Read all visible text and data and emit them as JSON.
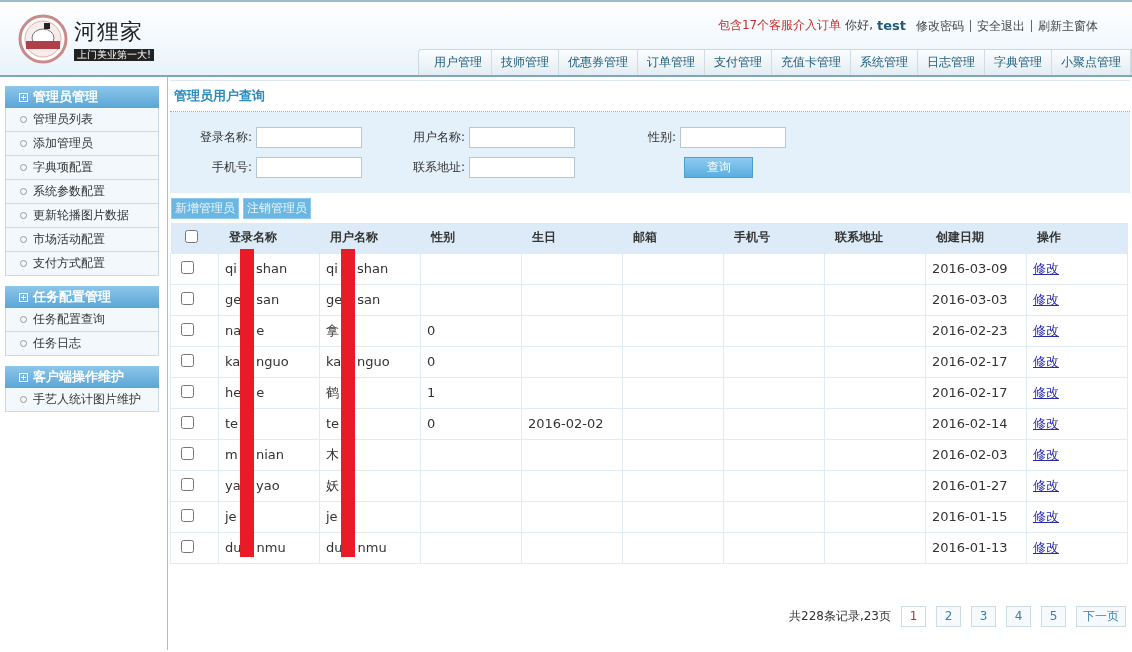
{
  "brand": {
    "name": "河狸家",
    "tagline": "上门美业第一大!"
  },
  "top_bar": {
    "alert": "包含17个客服介入订单",
    "greeting": "你好,",
    "user": "test",
    "links": [
      "修改密码",
      "安全退出",
      "刷新主窗体"
    ]
  },
  "nav_tabs": [
    "用户管理",
    "技师管理",
    "优惠券管理",
    "订单管理",
    "支付管理",
    "充值卡管理",
    "系统管理",
    "日志管理",
    "字典管理",
    "小聚点管理"
  ],
  "sidebar": [
    {
      "title": "管理员管理",
      "items": [
        "管理员列表",
        "添加管理员",
        "字典项配置",
        "系统参数配置",
        "更新轮播图片数据",
        "市场活动配置",
        "支付方式配置"
      ]
    },
    {
      "title": "任务配置管理",
      "items": [
        "任务配置查询",
        "任务日志"
      ]
    },
    {
      "title": "客户端操作维护",
      "items": [
        "手艺人统计图片维护"
      ]
    }
  ],
  "page_title": "管理员用户查询",
  "filters": [
    {
      "label": "登录名称:"
    },
    {
      "label": "用户名称:"
    },
    {
      "label": "性别:"
    },
    {
      "label": "手机号:"
    },
    {
      "label": "联系地址:"
    }
  ],
  "query_button": "查询",
  "actions": [
    "新增管理员",
    "注销管理员"
  ],
  "table": {
    "select_all_checked": false,
    "columns": [
      "登录名称",
      "用户名称",
      "性别",
      "生日",
      "邮箱",
      "手机号",
      "联系地址",
      "创建日期",
      "操作"
    ],
    "rows": [
      {
        "checked": false,
        "login_name": [
          "qi",
          "shan"
        ],
        "user_name": [
          "qi",
          "shan"
        ],
        "gender": "",
        "birthday": "",
        "created": "2016-03-09",
        "action": "修改"
      },
      {
        "checked": false,
        "login_name": [
          "ge",
          "san"
        ],
        "user_name": [
          "ge",
          "san"
        ],
        "gender": "",
        "birthday": "",
        "created": "2016-03-03",
        "action": "修改"
      },
      {
        "checked": false,
        "login_name": [
          "na",
          "e"
        ],
        "user_name": [
          "拿"
        ],
        "gender": "0",
        "birthday": "",
        "created": "2016-02-23",
        "action": "修改"
      },
      {
        "checked": false,
        "login_name": [
          "ka",
          "nguo"
        ],
        "user_name": [
          "ka",
          "nguo"
        ],
        "gender": "0",
        "birthday": "",
        "created": "2016-02-17",
        "action": "修改"
      },
      {
        "checked": false,
        "login_name": [
          "he",
          "e"
        ],
        "user_name": [
          "鹤"
        ],
        "gender": "1",
        "birthday": "",
        "created": "2016-02-17",
        "action": "修改"
      },
      {
        "checked": false,
        "login_name": [
          "te"
        ],
        "user_name": [
          "te"
        ],
        "gender": "0",
        "birthday": "2016-02-02",
        "created": "2016-02-14",
        "action": "修改"
      },
      {
        "checked": false,
        "login_name": [
          "m",
          "nian"
        ],
        "user_name": [
          "木"
        ],
        "gender": "",
        "birthday": "",
        "created": "2016-02-03",
        "action": "修改"
      },
      {
        "checked": false,
        "login_name": [
          "ya",
          "yao"
        ],
        "user_name": [
          "妖"
        ],
        "gender": "",
        "birthday": "",
        "created": "2016-01-27",
        "action": "修改"
      },
      {
        "checked": false,
        "login_name": [
          "je"
        ],
        "user_name": [
          "je"
        ],
        "gender": "",
        "birthday": "",
        "created": "2016-01-15",
        "action": "修改"
      },
      {
        "checked": false,
        "login_name": [
          "du",
          "nmu"
        ],
        "user_name": [
          "du",
          "nmu"
        ],
        "gender": "",
        "birthday": "",
        "created": "2016-01-13",
        "action": "修改"
      }
    ]
  },
  "pagination": {
    "summary": "共228条记录,23页",
    "pages": [
      {
        "label": "1",
        "selected": true
      },
      {
        "label": "2",
        "selected": false
      },
      {
        "label": "3",
        "selected": false
      },
      {
        "label": "4",
        "selected": false
      },
      {
        "label": "5",
        "selected": false
      },
      {
        "label": "下一页",
        "selected": false
      }
    ]
  }
}
